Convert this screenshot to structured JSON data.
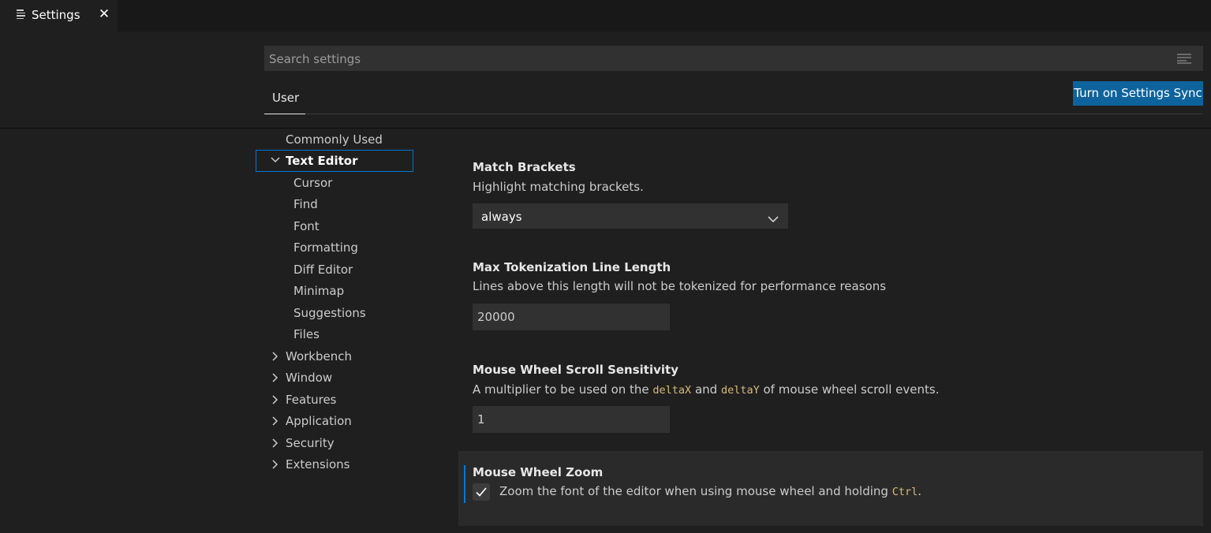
{
  "tab": {
    "title": "Settings",
    "close_glyph": "✕",
    "icon": "settings-preview-icon"
  },
  "search": {
    "placeholder": "Search settings",
    "filter_icon": "filter-icon"
  },
  "scope": {
    "active_tab": "User"
  },
  "sync_button": {
    "label": "Turn on Settings Sync"
  },
  "colors": {
    "accent": "#0078d4",
    "button_bg": "#0e639c",
    "code": "#d7ba7d",
    "background": "#1f1f1f"
  },
  "toc": {
    "commonly_used": "Commonly Used",
    "text_editor": "Text Editor",
    "text_editor_children": [
      "Cursor",
      "Find",
      "Font",
      "Formatting",
      "Diff Editor",
      "Minimap",
      "Suggestions",
      "Files"
    ],
    "collapsed_groups": [
      "Workbench",
      "Window",
      "Features",
      "Application",
      "Security",
      "Extensions"
    ]
  },
  "settings": [
    {
      "title": "Match Brackets",
      "description": "Highlight matching brackets.",
      "value": "always"
    },
    {
      "title": "Max Tokenization Line Length",
      "description": "Lines above this length will not be tokenized for performance reasons",
      "value": "20000"
    },
    {
      "title": "Mouse Wheel Scroll Sensitivity",
      "description_parts": [
        "A multiplier to be used on the ",
        "deltaX",
        " and ",
        "deltaY",
        " of mouse wheel scroll events."
      ],
      "value": "1"
    },
    {
      "title": "Mouse Wheel Zoom",
      "description_parts": [
        "Zoom the font of the editor when using mouse wheel and holding ",
        "Ctrl",
        "."
      ],
      "checked": true
    }
  ]
}
